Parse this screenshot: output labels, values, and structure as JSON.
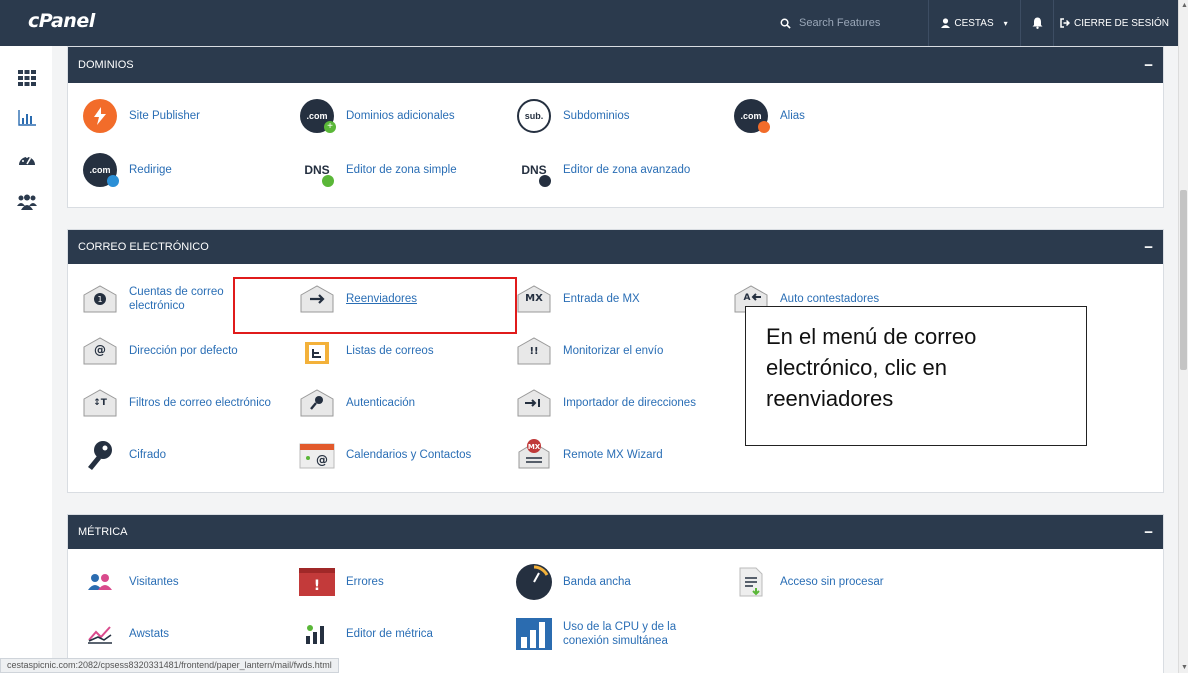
{
  "app": {
    "logo": "cPanel"
  },
  "topbar": {
    "search_placeholder": "Search Features",
    "user_label": "CESTAS",
    "logout_label": "CIERRE DE SESIÓN"
  },
  "sections": {
    "dominios": {
      "title": "DOMINIOS",
      "items": [
        {
          "label": "Site Publisher",
          "icon": "lightning-icon"
        },
        {
          "label": "Dominios adicionales",
          "icon": "dotcom-plus-icon"
        },
        {
          "label": "Subdominios",
          "icon": "sub-icon"
        },
        {
          "label": "Alias",
          "icon": "dotcom-alias-icon"
        },
        {
          "label": "Redirige",
          "icon": "dotcom-redirect-icon"
        },
        {
          "label": "Editor de zona simple",
          "icon": "dns-simple-icon"
        },
        {
          "label": "Editor de zona avanzado",
          "icon": "dns-advanced-icon"
        }
      ]
    },
    "correo": {
      "title": "CORREO ELECTRÓNICO",
      "items": [
        {
          "label": "Cuentas de correo electrónico",
          "icon": "email-accounts-icon"
        },
        {
          "label": "Reenviadores",
          "icon": "forwarders-icon"
        },
        {
          "label": "Entrada de MX",
          "icon": "mx-entry-icon"
        },
        {
          "label": "Auto contestadores",
          "icon": "autoresponder-icon"
        },
        {
          "label": "Dirección por defecto",
          "icon": "default-address-icon"
        },
        {
          "label": "Listas de correos",
          "icon": "mailing-lists-icon"
        },
        {
          "label": "Monitorizar el envío",
          "icon": "track-delivery-icon"
        },
        {
          "label": "Filtros de correo electrónico",
          "icon": "email-filters-icon"
        },
        {
          "label": "Autenticación",
          "icon": "authentication-icon"
        },
        {
          "label": "Importador de direcciones",
          "icon": "address-importer-icon"
        },
        {
          "label": "Cifrado",
          "icon": "encryption-key-icon"
        },
        {
          "label": "Calendarios y Contactos",
          "icon": "calendar-icon"
        },
        {
          "label": "Remote MX Wizard",
          "icon": "remote-mx-icon"
        }
      ]
    },
    "metrica": {
      "title": "MÉTRICA",
      "items": [
        {
          "label": "Visitantes",
          "icon": "visitors-icon"
        },
        {
          "label": "Errores",
          "icon": "errors-icon"
        },
        {
          "label": "Banda ancha",
          "icon": "bandwidth-gauge-icon"
        },
        {
          "label": "Acceso sin procesar",
          "icon": "raw-access-icon"
        },
        {
          "label": "Awstats",
          "icon": "awstats-icon"
        },
        {
          "label": "Editor de métrica",
          "icon": "metrics-editor-icon"
        },
        {
          "label": "Uso de la CPU y de la conexión simultánea",
          "icon": "cpu-usage-icon"
        }
      ]
    }
  },
  "callout": {
    "text": "En el menú de correo electrónico, clic en reenviadores"
  },
  "statusbar": {
    "url": "cestaspicnic.com:2082/cpsess8320331481/frontend/paper_lantern/mail/fwds.html"
  },
  "colors": {
    "header": "#2b3a4d",
    "link": "#2a6eb5",
    "highlight": "#e01b1b",
    "background": "#f3f4f5"
  }
}
